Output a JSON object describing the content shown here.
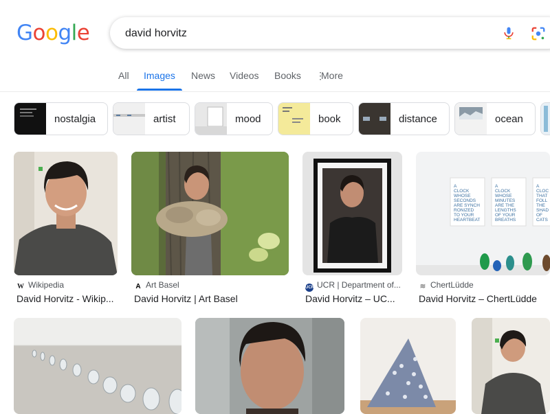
{
  "logo": {
    "letters": [
      "G",
      "o",
      "o",
      "g",
      "l",
      "e"
    ],
    "colors": [
      "#4285F4",
      "#EA4335",
      "#FBBC05",
      "#4285F4",
      "#34A853",
      "#EA4335"
    ]
  },
  "search": {
    "query": "david horvitz",
    "mic_icon": "mic-icon",
    "lens_icon": "google-lens-icon"
  },
  "tabs": [
    {
      "label": "All",
      "active": false
    },
    {
      "label": "Images",
      "active": true
    },
    {
      "label": "News",
      "active": false
    },
    {
      "label": "Videos",
      "active": false
    },
    {
      "label": "Books",
      "active": false
    },
    {
      "label": "More",
      "active": false
    }
  ],
  "chips": [
    {
      "label": "nostalgia"
    },
    {
      "label": "artist"
    },
    {
      "label": "mood"
    },
    {
      "label": "book"
    },
    {
      "label": "distance"
    },
    {
      "label": "ocean"
    }
  ],
  "results": [
    {
      "source": "Wikipedia",
      "title": "David Horvitz - Wikip..."
    },
    {
      "source": "Art Basel",
      "title": "David Horvitz | Art Basel"
    },
    {
      "source": "UCR | Department of...",
      "title": "David Horvitz – UC..."
    },
    {
      "source": "ChertLüdde",
      "title": "David Horvitz – ChertLüdde"
    },
    {
      "source": "",
      "title": ""
    },
    {
      "source": "",
      "title": ""
    },
    {
      "source": "",
      "title": ""
    },
    {
      "source": "",
      "title": ""
    }
  ],
  "artwork_texts": [
    "A CLOCK WHOSE SECONDS ARE SYNCH RONIZED TO YOUR HEARTBEAT",
    "A CLOCK WHOSE MINUTES ARE THE LENGTHS OF YOUR BREATHS",
    "A CLOCK THAT FOLLOWS THE SHADOWS OF CATS"
  ],
  "colors": {
    "accent": "#1a73e8",
    "text": "#202124",
    "muted": "#5f6368"
  }
}
